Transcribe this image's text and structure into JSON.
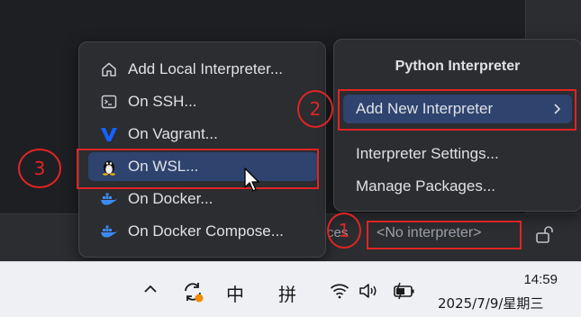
{
  "interpreter_menu": {
    "items": [
      {
        "label": "Add Local Interpreter...",
        "icon": "home-icon"
      },
      {
        "label": "On SSH...",
        "icon": "terminal-icon"
      },
      {
        "label": "On Vagrant...",
        "icon": "vagrant-icon"
      },
      {
        "label": "On WSL...",
        "icon": "linux-penguin-icon",
        "selected": true
      },
      {
        "label": "On Docker...",
        "icon": "docker-icon"
      },
      {
        "label": "On Docker Compose...",
        "icon": "docker-compose-icon"
      }
    ]
  },
  "python_interpreter_popup": {
    "title": "Python Interpreter",
    "add_new": "Add New Interpreter",
    "settings": "Interpreter Settings...",
    "manage": "Manage Packages..."
  },
  "status_bar": {
    "partial_text": "ces",
    "interpreter": "<No interpreter>"
  },
  "annotations": {
    "step1": "1",
    "step2": "2",
    "step3": "3",
    "color": "#e02424"
  },
  "taskbar": {
    "ime_mode": "中",
    "ime_input": "拼",
    "time": "14:59",
    "date": "2025/7/9/星期三"
  },
  "colors": {
    "selection": "#2e436e",
    "popup_bg": "#2b2d30",
    "ide_bg": "#1e1f22",
    "vagrant_blue": "#1563ff",
    "docker_blue": "#3d8bf2"
  }
}
